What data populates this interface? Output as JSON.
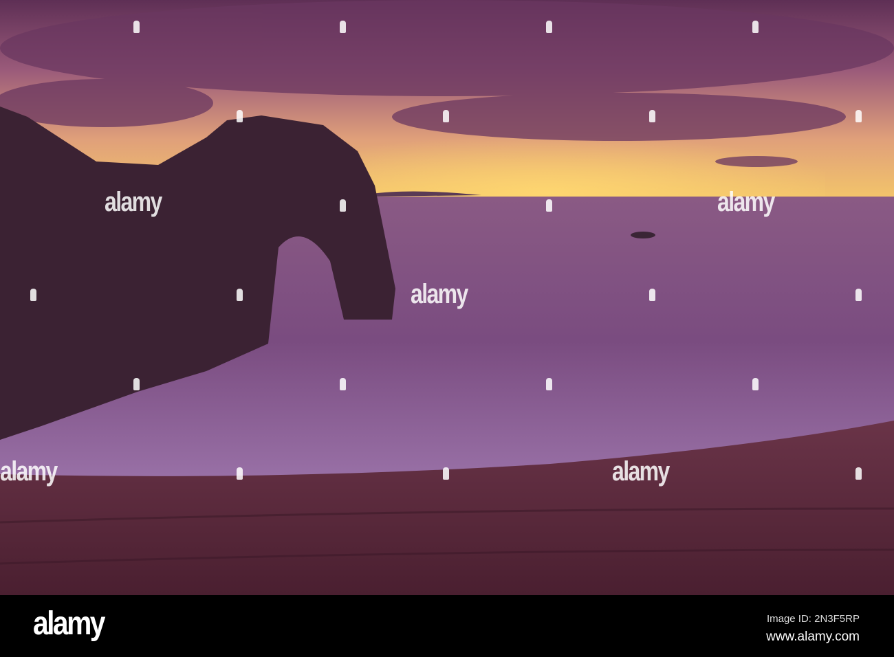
{
  "watermark": {
    "text": "alamy"
  },
  "footer": {
    "logo": "alamy",
    "image_id": "Image ID: 2N3F5RP",
    "website": "www.alamy.com"
  }
}
